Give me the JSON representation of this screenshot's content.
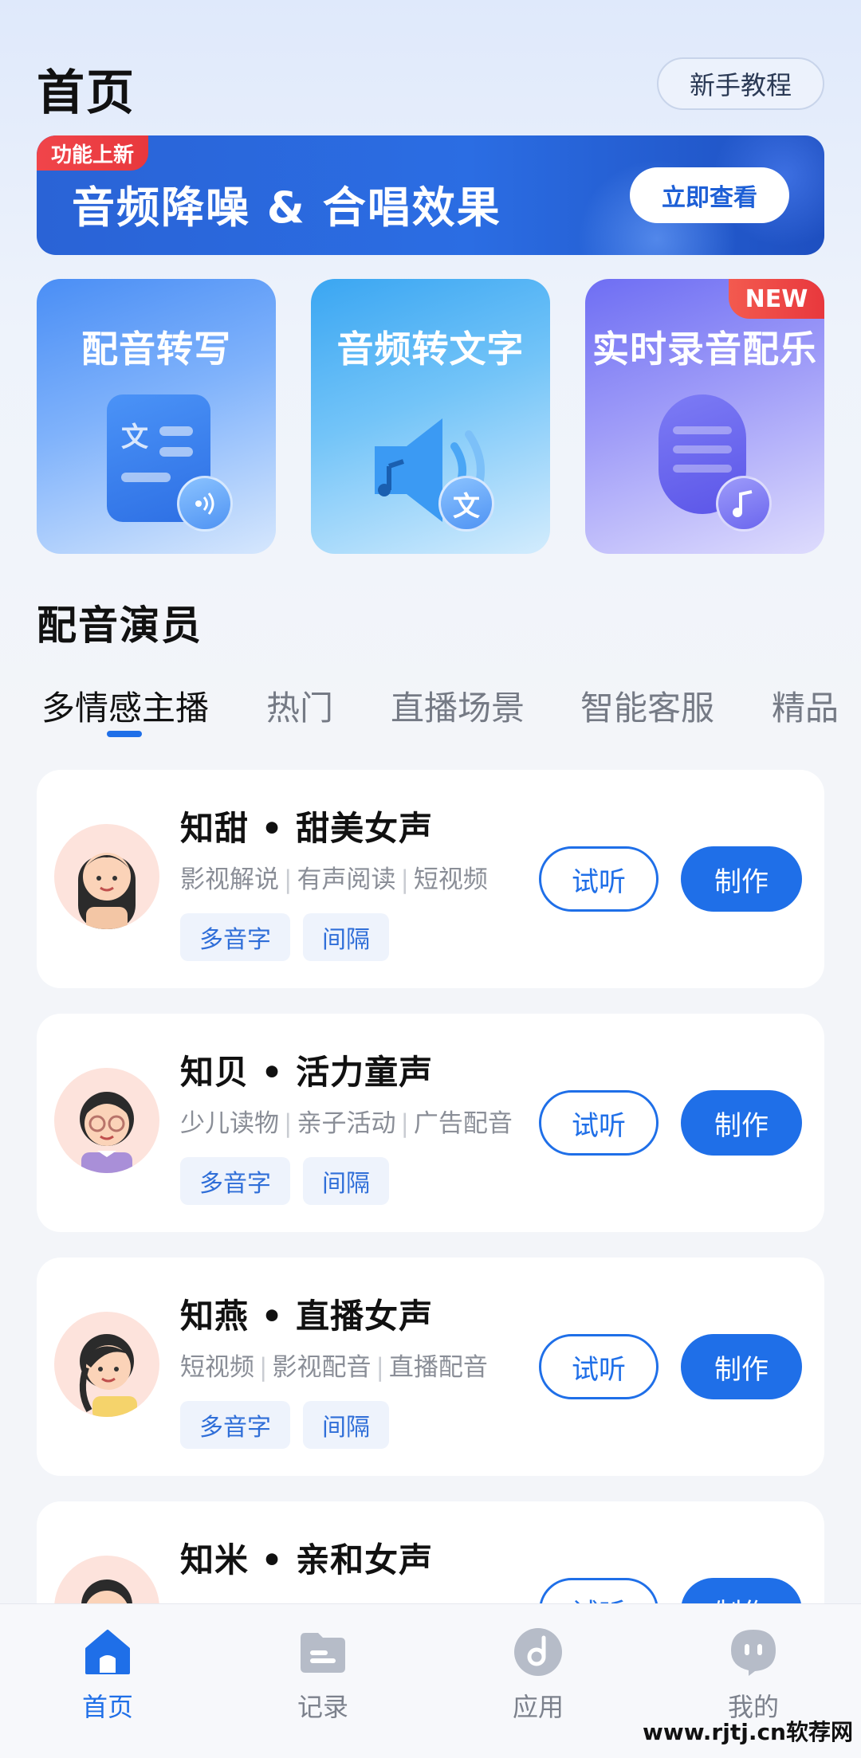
{
  "header": {
    "title": "首页",
    "tutorial_label": "新手教程"
  },
  "banner": {
    "tag": "功能上新",
    "title": "音频降噪 & 合唱效果",
    "button": "立即查看"
  },
  "features": [
    {
      "title": "配音转写",
      "badge_icon": "audio-waves-icon"
    },
    {
      "title": "音频转文字",
      "badge_text": "文"
    },
    {
      "title": "实时录音配乐",
      "badge": "NEW",
      "badge_icon": "music-note-icon"
    }
  ],
  "doc_icon_text": "文",
  "section": {
    "title": "配音演员"
  },
  "tabs": [
    {
      "label": "多情感主播",
      "active": true
    },
    {
      "label": "热门"
    },
    {
      "label": "直播场景"
    },
    {
      "label": "智能客服"
    },
    {
      "label": "精品"
    }
  ],
  "voices": [
    {
      "name": "知甜 • 甜美女声",
      "tags": [
        "影视解说",
        "有声阅读",
        "短视频"
      ],
      "chips": [
        "多音字",
        "间隔"
      ],
      "listen": "试听",
      "make": "制作"
    },
    {
      "name": "知贝 • 活力童声",
      "tags": [
        "少儿读物",
        "亲子活动",
        "广告配音"
      ],
      "chips": [
        "多音字",
        "间隔"
      ],
      "listen": "试听",
      "make": "制作"
    },
    {
      "name": "知燕 • 直播女声",
      "tags": [
        "短视频",
        "影视配音",
        "直播配音"
      ],
      "chips": [
        "多音字",
        "间隔"
      ],
      "listen": "试听",
      "make": "制作"
    },
    {
      "name": "知米 • 亲和女声",
      "tags": [],
      "chips": [],
      "listen": "试听",
      "make": "制作"
    }
  ],
  "bottom_nav": [
    {
      "label": "首页",
      "icon": "home-icon",
      "active": true
    },
    {
      "label": "记录",
      "icon": "folder-icon"
    },
    {
      "label": "应用",
      "icon": "music-disc-icon"
    },
    {
      "label": "我的",
      "icon": "profile-chat-icon"
    }
  ],
  "watermark": "www.rjtj.cn软荐网",
  "colors": {
    "primary": "#1f6fe8",
    "badge_red": "#e8383d",
    "banner_blue": "#2b6de3"
  }
}
